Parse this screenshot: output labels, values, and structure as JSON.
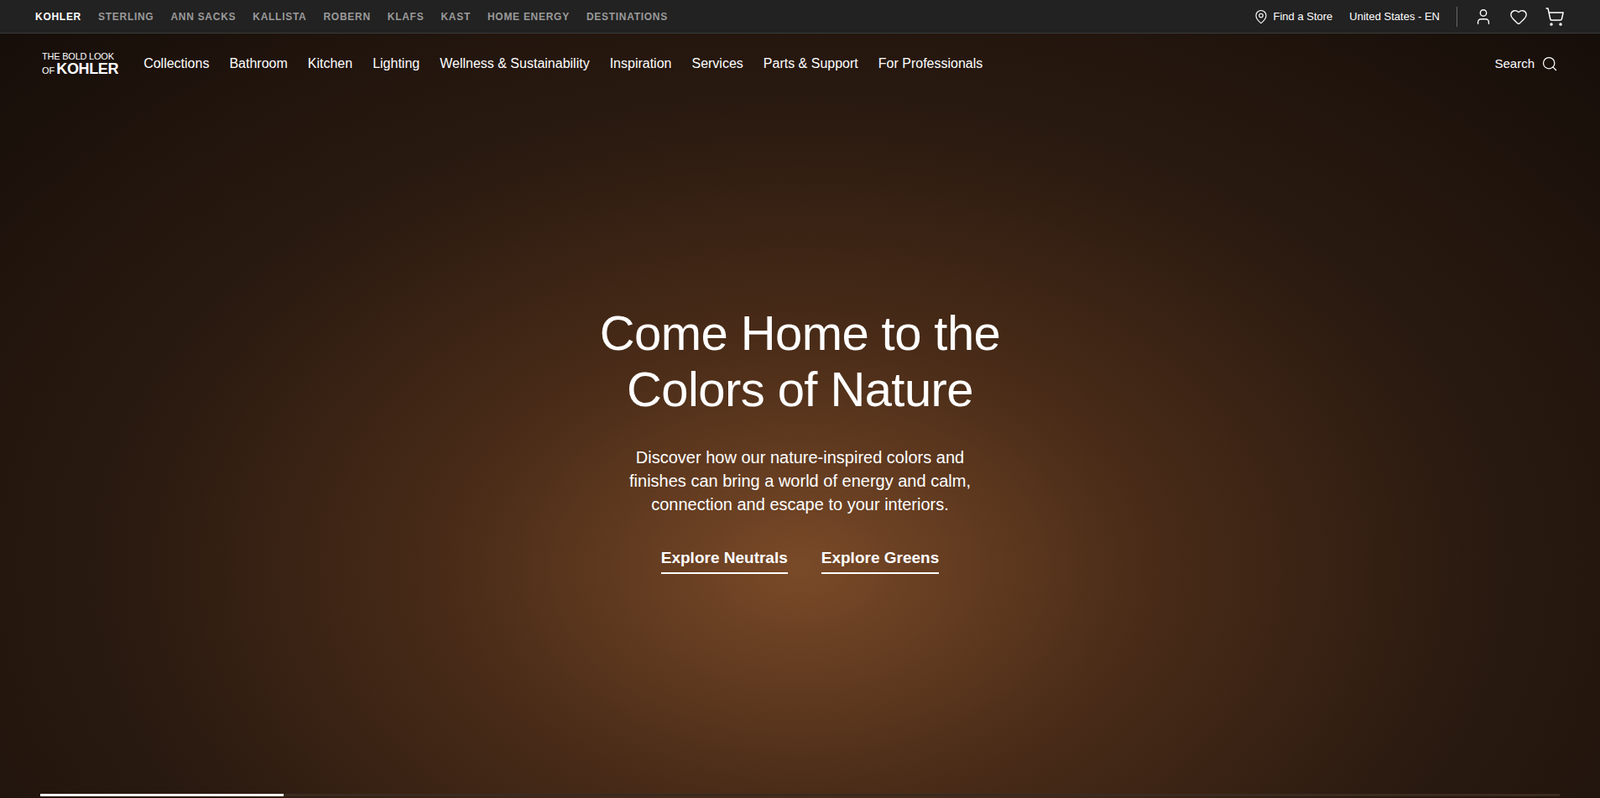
{
  "brands": [
    {
      "label": "KOHLER",
      "selected": true
    },
    {
      "label": "STERLING",
      "selected": false
    },
    {
      "label": "ANN SACKS",
      "selected": false
    },
    {
      "label": "KALLISTA",
      "selected": false
    },
    {
      "label": "ROBERN",
      "selected": false
    },
    {
      "label": "KLAFS",
      "selected": false
    },
    {
      "label": "KAST",
      "selected": false
    },
    {
      "label": "HOME ENERGY",
      "selected": false
    },
    {
      "label": "DESTINATIONS",
      "selected": false
    }
  ],
  "utility": {
    "find_store": "Find a Store",
    "locale": "United States - EN"
  },
  "logo": {
    "line1": "THE BOLD LOOK",
    "prefix": "OF",
    "brand": "KOHLER"
  },
  "nav": [
    "Collections",
    "Bathroom",
    "Kitchen",
    "Lighting",
    "Wellness & Sustainability",
    "Inspiration",
    "Services",
    "Parts & Support",
    "For Professionals"
  ],
  "search": {
    "label": "Search"
  },
  "hero": {
    "title": "Come Home to the Colors of Nature",
    "subtitle": "Discover how our nature-inspired colors and finishes can bring a world of energy and calm, connection and escape to your interiors.",
    "links": [
      "Explore Neutrals",
      "Explore Greens"
    ]
  },
  "carousel": {
    "level": 0.16
  }
}
